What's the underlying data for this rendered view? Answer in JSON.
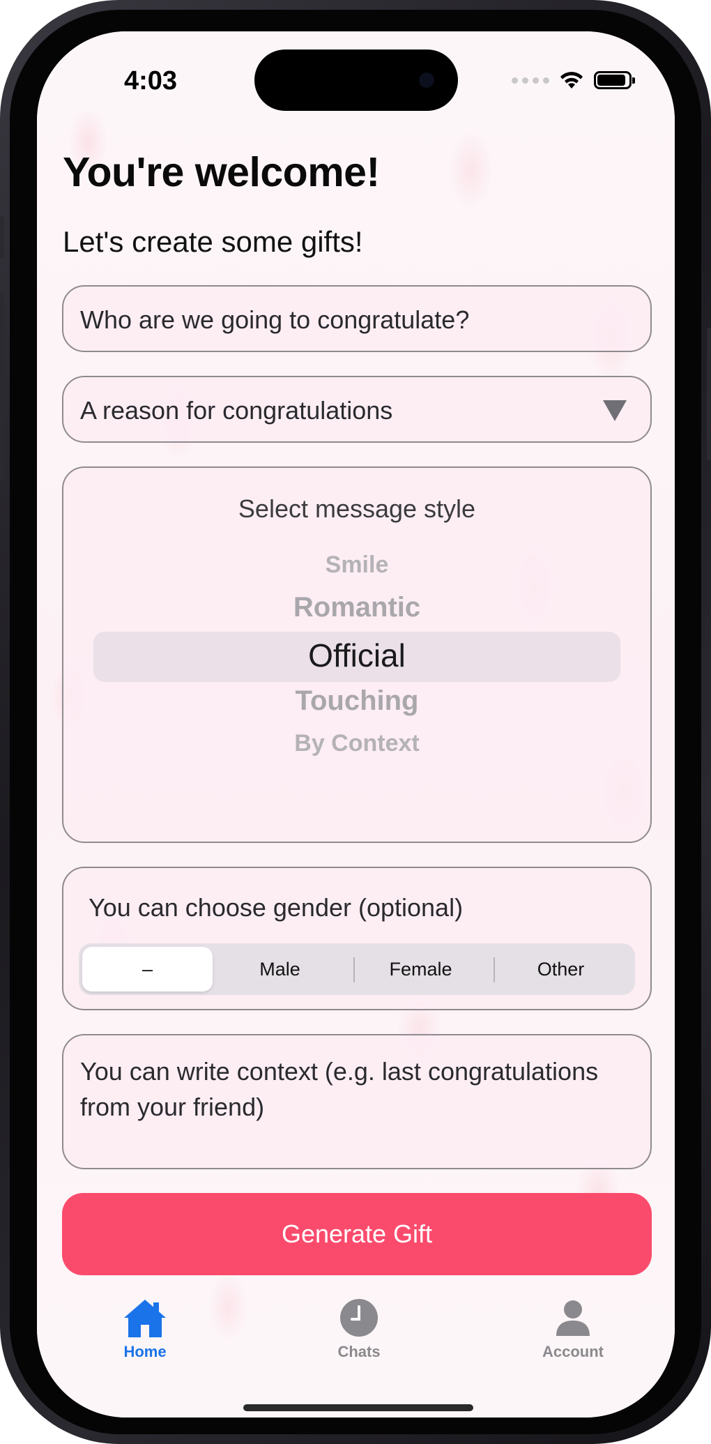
{
  "status_bar": {
    "time": "4:03"
  },
  "header": {
    "title": "You're welcome!",
    "subtitle": "Let's create some gifts!"
  },
  "form": {
    "recipient_placeholder": "Who are we going to congratulate?",
    "reason_placeholder": "A reason for congratulations",
    "style_picker": {
      "label": "Select message style",
      "options": [
        "Smile",
        "Romantic",
        "Official",
        "Touching",
        "By Context"
      ],
      "selected": "Official"
    },
    "gender": {
      "label": "You can choose gender (optional)",
      "options": [
        "–",
        "Male",
        "Female",
        "Other"
      ],
      "selected": "–"
    },
    "context_placeholder": "You can write context (e.g. last congratulations from your friend)",
    "generate_label": "Generate Gift"
  },
  "tabbar": {
    "items": [
      {
        "label": "Home",
        "icon": "house-icon",
        "active": true
      },
      {
        "label": "Chats",
        "icon": "clock-icon",
        "active": false
      },
      {
        "label": "Account",
        "icon": "person-icon",
        "active": false
      }
    ]
  },
  "colors": {
    "accent": "#fa4b6c",
    "tab_active": "#1a73e8",
    "tab_inactive": "#8a898d"
  }
}
